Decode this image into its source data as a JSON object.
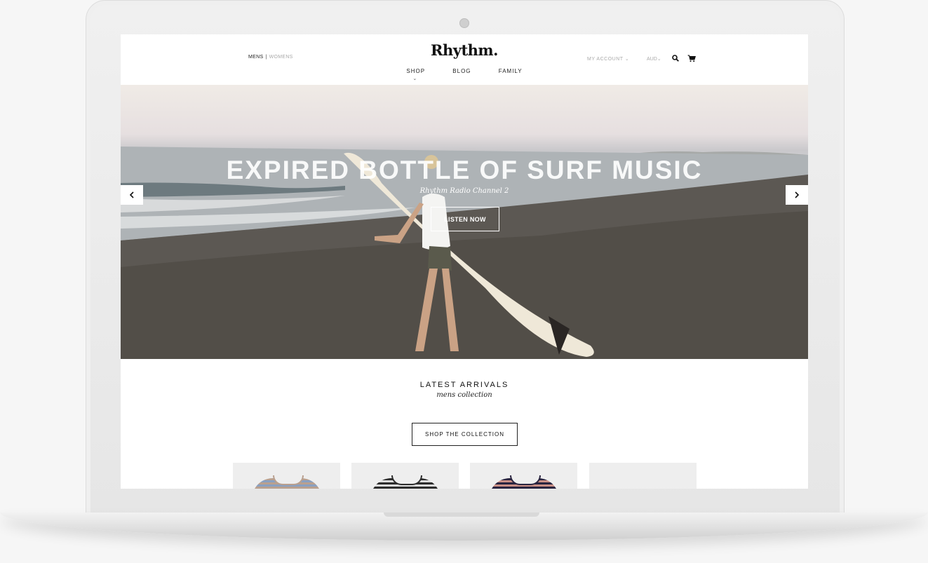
{
  "header": {
    "gender": {
      "mens": "MENS",
      "separator": "|",
      "womens": "WOMENS"
    },
    "logo": "Rhythm.",
    "nav": [
      {
        "label": "SHOP"
      },
      {
        "label": "BLOG"
      },
      {
        "label": "FAMILY"
      }
    ],
    "account_label": "MY ACCOUNT",
    "currency": "AUD"
  },
  "hero": {
    "title": "EXPIRED BOTTLE OF SURF MUSIC",
    "subtitle": "Rhythm Radio Channel 2",
    "button_label": "LISTEN NOW"
  },
  "arrivals": {
    "title": "LATEST ARRIVALS",
    "subtitle": "mens collection",
    "button_label": "SHOP THE COLLECTION"
  },
  "products": [
    {
      "stripe_colors": [
        "#b9a08f",
        "#8aa0c0"
      ]
    },
    {
      "stripe_colors": [
        "#2d2d2d",
        "#dcdcdc"
      ]
    },
    {
      "stripe_colors": [
        "#2b2540",
        "#c98f86"
      ]
    },
    {
      "stripe_colors": []
    }
  ]
}
